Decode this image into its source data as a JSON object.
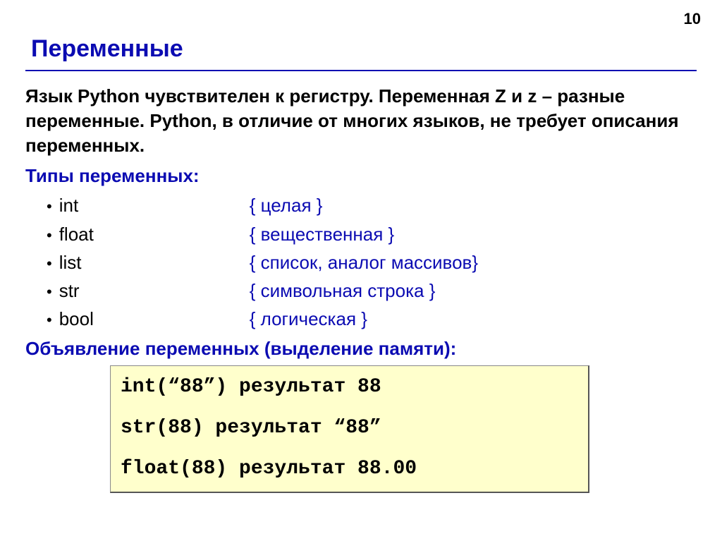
{
  "page_number": "10",
  "title": "Переменные",
  "intro": "Язык Python чувствителен к регистру. Переменная Z и z – разные переменные. Python, в отличие от многих языков, не требует описания переменных.",
  "types_heading": "Типы переменных:",
  "types": [
    {
      "name": "int",
      "desc": "{ целая }"
    },
    {
      "name": "float",
      "desc": "{ вещественная }"
    },
    {
      "name": "list",
      "desc": "{ список, аналог массивов}"
    },
    {
      "name": "str",
      "desc": "{ символьная строка }"
    },
    {
      "name": "bool",
      "desc": "{ логическая }"
    }
  ],
  "decl_heading": "Объявление переменных (выделение памяти):",
  "code": {
    "l1": "int(“88”) результат 88",
    "l2": "str(88) результат “88”",
    "l3": "float(88) результат 88.00"
  }
}
